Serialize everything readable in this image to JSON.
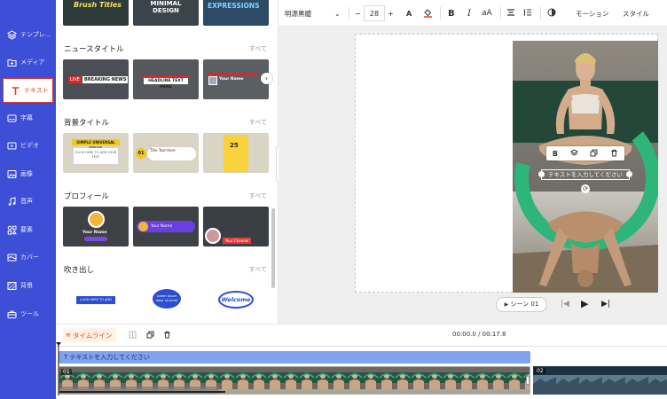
{
  "nav": {
    "items": [
      {
        "label": "テンプレ..."
      },
      {
        "label": "メディア"
      },
      {
        "label": "テキスト"
      },
      {
        "label": "字幕"
      },
      {
        "label": "ビデオ"
      },
      {
        "label": "画像"
      },
      {
        "label": "音声"
      },
      {
        "label": "要素"
      },
      {
        "label": "カバー"
      },
      {
        "label": "背景"
      },
      {
        "label": "ツール"
      }
    ]
  },
  "panel": {
    "top_thumbs": [
      "Brush Titles",
      "MINIMAL DESIGN",
      "EXPRESSIONS"
    ],
    "sections": [
      {
        "title": "ニュースタイトル",
        "all": "すべて",
        "thumbs": [
          "BREAKING NEWS",
          "HEADLINE TEXT HERE",
          "Your Name"
        ],
        "thumb_prefix": "LIVE"
      },
      {
        "title": "背景タイトル",
        "all": "すべて",
        "thumbs": [
          "SIMPLE UNIVERSAL TITLES",
          "Title Text Here",
          "25"
        ],
        "thumb_num": "01",
        "thumb_text": "CLICK HERE TO ADD YOUR TEXT"
      },
      {
        "title": "プロフィール",
        "all": "すべて",
        "thumbs": [
          "Your Name",
          "Your Name",
          "Your Channel"
        ]
      },
      {
        "title": "吹き出し",
        "all": "すべて",
        "thumbs": [
          "CLICK HERE TO ADD TEXT",
          "Lorem ipsum dolor sit amet",
          "Welcome"
        ]
      }
    ]
  },
  "toolbar": {
    "font": "明源黒體",
    "size": "28",
    "minus": "−",
    "plus": "+",
    "bold": "B",
    "italic": "I",
    "case": "aA",
    "motion": "モーション",
    "style": "スタイル"
  },
  "canvas": {
    "text_box": "テキストを入力してください",
    "scene_label": "シーン 01"
  },
  "timeline": {
    "label": "タイムライン",
    "time": "00:00.0 / 00:17.8",
    "text_track": "テキストを入力してください",
    "clip1_num": "01",
    "clip2_num": "02"
  },
  "colors": {
    "nav_bg": "#3d4fd6",
    "accent_red": "#e5401f",
    "track_blue": "#7fa3ee",
    "canvas_bg": "#efefef",
    "yoga_green": "#2db57a"
  }
}
